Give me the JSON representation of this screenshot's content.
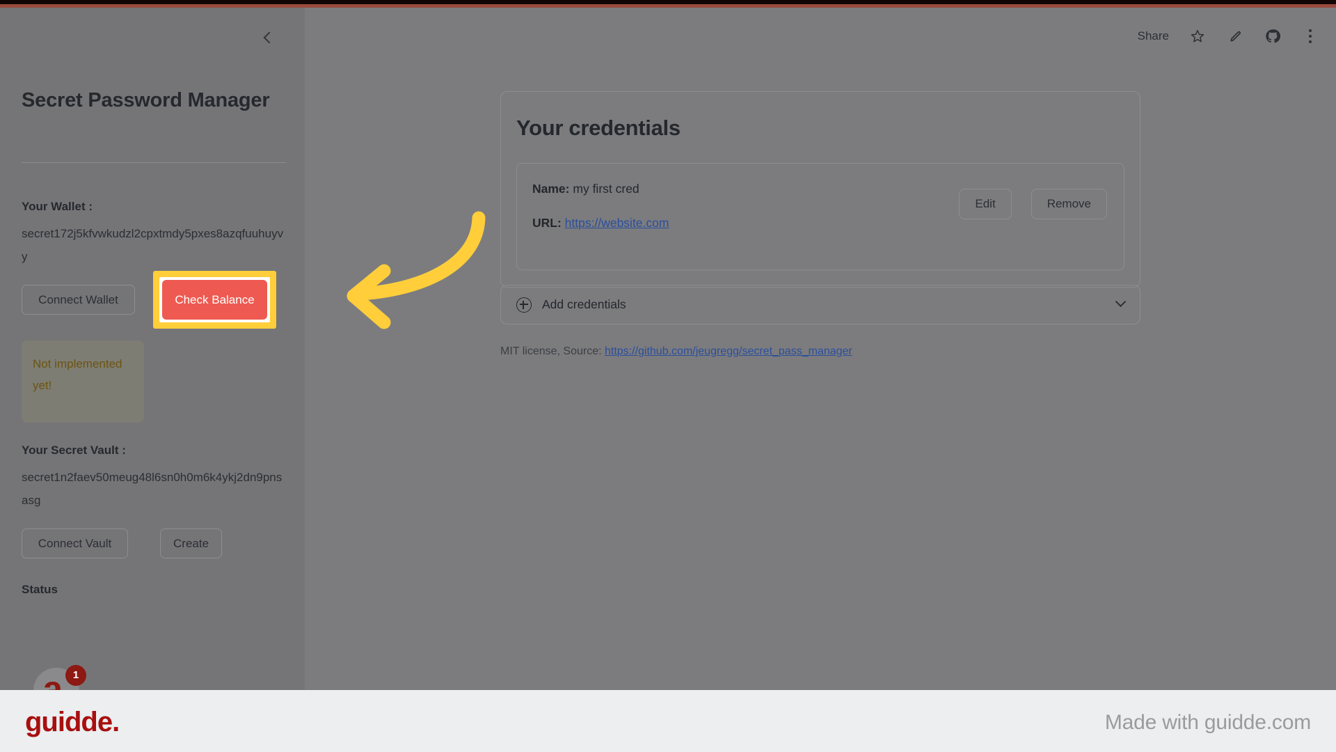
{
  "browser": {
    "toolbar": {
      "share_label": "Share",
      "icons": [
        "star-icon",
        "pencil-icon",
        "github-icon",
        "kebab-menu-icon"
      ]
    }
  },
  "sidebar": {
    "collapse_icon": "chevron-left-icon",
    "title": "Secret Password Manager",
    "wallet": {
      "label": "Your Wallet :",
      "address": "secret172j5kfvwkudzl2cpxtmdy5pxes8azqfuuhuyvy",
      "connect_button": "Connect Wallet",
      "check_button": "Check Balance"
    },
    "alert": {
      "text": "Not implemented yet!",
      "color": "#6b5410"
    },
    "vault": {
      "label": "Your Secret Vault :",
      "address": "secret1n2faev50meug48l6sn0h0m6k4ykj2dn9pnsasg",
      "connect_button": "Connect Vault",
      "create_button": "Create"
    },
    "status_label": "Status",
    "avatar": {
      "glyph": "a.",
      "badge_count": "1"
    }
  },
  "main": {
    "panel_title": "Your credentials",
    "credentials": [
      {
        "name_label": "Name:",
        "name_value": "my first cred",
        "url_label": "URL:",
        "url_value": "https://website.com",
        "edit_button": "Edit",
        "remove_button": "Remove"
      }
    ],
    "add_credentials": {
      "label": "Add credentials",
      "plus_icon": "plus-circle-icon",
      "expand_icon": "chevron-down-icon"
    },
    "license": {
      "prefix": "MIT license, Source: ",
      "link_text": "https://github.com/jeugregg/secret_pass_manager"
    }
  },
  "annotation": {
    "arrow_color": "#ffce3a",
    "highlight_color": "#ffce3a",
    "target": "check-balance-button"
  },
  "footer": {
    "logo_text": "guidde.",
    "right_text": "Made with guidde.com"
  }
}
